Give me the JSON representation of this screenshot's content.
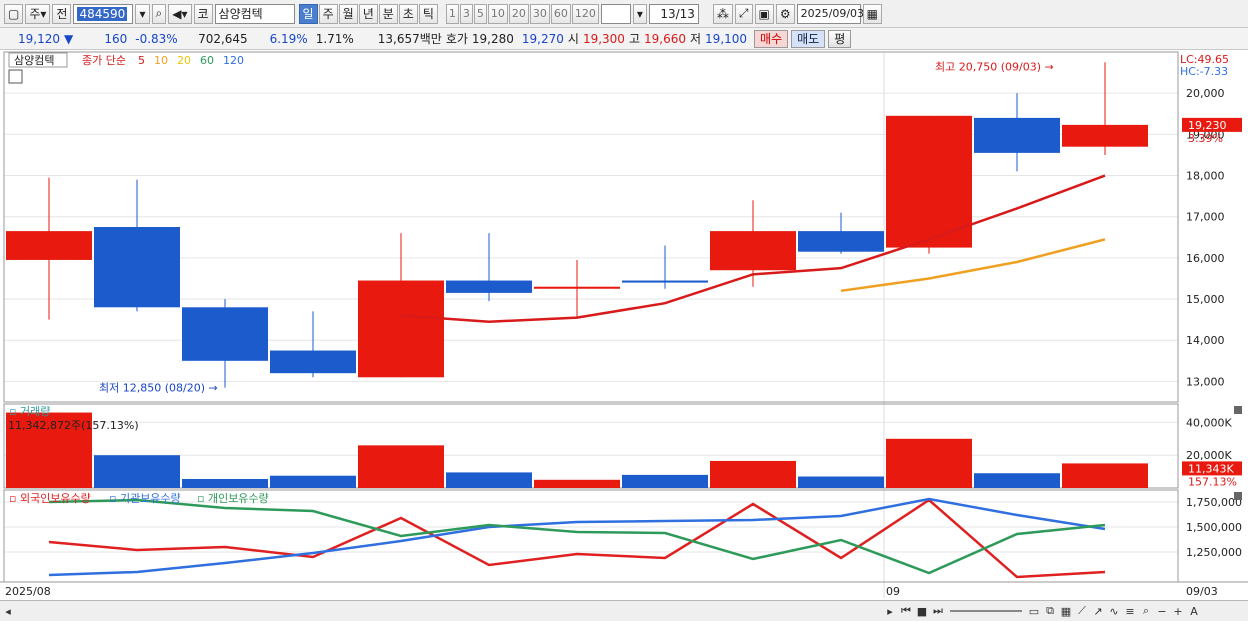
{
  "toolbar": {
    "period_label": "주",
    "prev_label": "전",
    "code": "484590",
    "market_badge": "코",
    "stock_name": "삼양컴텍",
    "timeframes": [
      "일",
      "주",
      "월",
      "년",
      "분",
      "초",
      "틱"
    ],
    "active_timeframe": "일",
    "intervals": [
      "1",
      "3",
      "5",
      "10",
      "20",
      "30",
      "60",
      "120"
    ],
    "count": "13/13",
    "date": "2025/09/03"
  },
  "quote": {
    "price": "19,120",
    "change_arrow": "▼",
    "change": "160",
    "change_pct": "-0.83%",
    "volume": "702,645",
    "turnover_pct": "6.19%",
    "ratio_pct": "1.71%",
    "amount": "13,657백만",
    "bid_label": "호가",
    "bid1": "19,280",
    "bid2": "19,270",
    "open_label": "시",
    "open": "19,300",
    "high_label": "고",
    "high": "19,660",
    "low_label": "저",
    "low": "19,100",
    "buy_label": "매수",
    "sell_label": "매도",
    "eval_label": "평"
  },
  "price_panel": {
    "title": "삼양컴텍",
    "legend_main": "종가 단순",
    "ma_legend": [
      "5",
      "10",
      "20",
      "60",
      "120"
    ],
    "lc": "LC:49.65",
    "hc": "HC:-7.33",
    "current_price": "19,230",
    "current_pct": "3.39%",
    "max_label": "최고 20,750 (09/03)",
    "min_label": "최저 12,850 (08/20)",
    "y_ticks": [
      "20,000",
      "19,000",
      "18,000",
      "17,000",
      "16,000",
      "15,000",
      "14,000",
      "13,000"
    ]
  },
  "volume_panel": {
    "title": "거래량",
    "info": "11,342,872주(157.13%)",
    "y_ticks": [
      "40,000K",
      "20,000K"
    ],
    "current": "11,343K",
    "current_pct": "157.13%"
  },
  "holding_panel": {
    "legend": [
      "외국인보유수량",
      "기관보유수량",
      "개인보유수량"
    ],
    "y_ticks": [
      "1,750,000",
      "1,500,000",
      "1,250,000"
    ]
  },
  "x_axis": {
    "left_label": "2025/08",
    "mid_label": "09",
    "right_label": "09/03"
  },
  "colors": {
    "up": "#e8190e",
    "down": "#1c5bcc",
    "ma5": "#d81a1a",
    "ma10": "#f0a020",
    "foreign": "#e02020",
    "institution": "#2f6fe0",
    "individual": "#2e9a5a"
  },
  "chart_data": {
    "type": "candlestick",
    "candles": [
      {
        "o": 15950,
        "h": 17950,
        "l": 14500,
        "c": 16650
      },
      {
        "o": 16750,
        "h": 17900,
        "l": 14700,
        "c": 14800
      },
      {
        "o": 14800,
        "h": 15000,
        "l": 12850,
        "c": 13500
      },
      {
        "o": 13750,
        "h": 14700,
        "l": 13100,
        "c": 13200
      },
      {
        "o": 13100,
        "h": 16600,
        "l": 13100,
        "c": 15450
      },
      {
        "o": 15450,
        "h": 16600,
        "l": 14950,
        "c": 15150
      },
      {
        "o": 15250,
        "h": 15950,
        "l": 14550,
        "c": 15300
      },
      {
        "o": 15450,
        "h": 16300,
        "l": 15250,
        "c": 15400
      },
      {
        "o": 15700,
        "h": 17400,
        "l": 15300,
        "c": 16650
      },
      {
        "o": 16650,
        "h": 17100,
        "l": 16100,
        "c": 16150
      },
      {
        "o": 16250,
        "h": 19450,
        "l": 16100,
        "c": 19450
      },
      {
        "o": 19400,
        "h": 20000,
        "l": 18100,
        "c": 18550
      },
      {
        "o": 18700,
        "h": 20750,
        "l": 18500,
        "c": 19230
      }
    ],
    "ma5": [
      null,
      null,
      null,
      null,
      14600,
      14450,
      14550,
      14900,
      15600,
      15750,
      16450,
      17200,
      18000
    ],
    "ma10": [
      null,
      null,
      null,
      null,
      null,
      null,
      null,
      null,
      null,
      15200,
      15500,
      15900,
      16450
    ],
    "volume": [
      46000,
      20000,
      5500,
      7500,
      26000,
      9500,
      5000,
      8000,
      16500,
      7000,
      30000,
      9000,
      15000
    ],
    "foreign": [
      1350000,
      1270000,
      1300000,
      1200000,
      1590000,
      1120000,
      1230000,
      1190000,
      1730000,
      1190000,
      1770000,
      1000000,
      1050000
    ],
    "institution": [
      1020000,
      1050000,
      1140000,
      1240000,
      1360000,
      1500000,
      1550000,
      1560000,
      1570000,
      1610000,
      1780000,
      1620000,
      1480000
    ],
    "individual": [
      1750000,
      1770000,
      1690000,
      1660000,
      1410000,
      1520000,
      1450000,
      1440000,
      1180000,
      1370000,
      1040000,
      1430000,
      1520000
    ],
    "price_range": [
      12500,
      21000
    ],
    "volume_range": [
      0,
      50000
    ],
    "holding_range": [
      950000,
      1850000
    ]
  }
}
